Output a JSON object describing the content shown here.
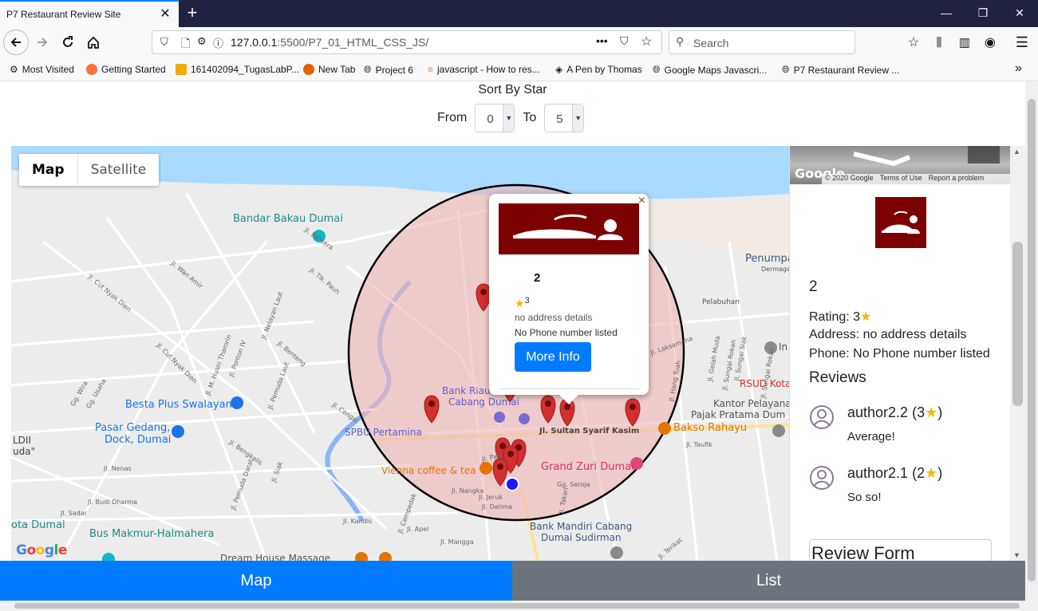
{
  "browser": {
    "tab_title": "P7 Restaurant Review Site",
    "url_host": "127.0.0.1",
    "url_rest": ":5500/P7_01_HTML_CSS_JS/",
    "url_menu": "•••",
    "search_placeholder": "Search",
    "bookmarks": [
      {
        "label": "Most Visited",
        "icon": "gear-icon"
      },
      {
        "label": "Getting Started",
        "icon": "firefox-icon"
      },
      {
        "label": "161402094_TugasLabP...",
        "icon": "doc-icon"
      },
      {
        "label": "New Tab",
        "icon": "firefox-icon"
      },
      {
        "label": "Project 6",
        "icon": "globe-icon"
      },
      {
        "label": "javascript - How to res...",
        "icon": "stackoverflow-icon"
      },
      {
        "label": "A Pen by Thomas",
        "icon": "codepen-icon"
      },
      {
        "label": "Google Maps Javascri...",
        "icon": "globe-icon"
      },
      {
        "label": "P7 Restaurant Review ...",
        "icon": "globe-icon"
      }
    ]
  },
  "sort": {
    "title": "Sort By Star",
    "from_label": "From",
    "from_value": "0",
    "to_label": "To",
    "to_value": "5"
  },
  "map": {
    "type_map": "Map",
    "type_satellite": "Satellite",
    "labels": [
      {
        "text": "Bandar Bakau Dumai",
        "color": "#1e8a8a"
      },
      {
        "text": "Penumpa",
        "color": "#3d5a80"
      },
      {
        "text": "Besta Plus Swalayan",
        "color": "#1a73e8"
      },
      {
        "text": "Pasar Gedang,",
        "color": "#1a73e8"
      },
      {
        "text": "Dock, Dumai",
        "color": "#1a73e8"
      },
      {
        "text": "Bank Riau",
        "color": "#5f5fd0"
      },
      {
        "text": "Cabang Dumai",
        "color": "#5f5fd0"
      },
      {
        "text": "SPBU Pertamina",
        "color": "#5f5fd0"
      },
      {
        "text": "Jl. Sultan Syarif Kasim",
        "color": "#444444"
      },
      {
        "text": "Grand Zuri Dumai",
        "color": "#d8336b"
      },
      {
        "text": "Vienna coffee & tea",
        "color": "#e37400"
      },
      {
        "text": "Bakso Rahayu",
        "color": "#e37400"
      },
      {
        "text": "Bank Mandiri Cabang",
        "color": "#3d5a80"
      },
      {
        "text": "Dumai Sudirman",
        "color": "#3d5a80"
      },
      {
        "text": "Kantor Pelayanan",
        "color": "#555555"
      },
      {
        "text": "Pajak Pratama Dum",
        "color": "#555555"
      },
      {
        "text": "RSUD Kota",
        "color": "#d93025"
      },
      {
        "text": "Bus Makmur-Halmahera",
        "color": "#1e8a8a"
      },
      {
        "text": "ota Dumai",
        "color": "#1e8a8a"
      },
      {
        "text": "LDII",
        "color": "#444444"
      },
      {
        "text": "uda\"",
        "color": "#444444"
      },
      {
        "text": "Dream House Massage",
        "color": "#555555"
      },
      {
        "text": "Pelabuhan",
        "color": "#555555"
      },
      {
        "text": "Dermaga",
        "color": "#555555"
      },
      {
        "text": "In",
        "color": "#555555"
      },
      {
        "text": "Google",
        "color": "#4285f4"
      }
    ],
    "roads": [
      "Jl. Bahtera",
      "Jl. Wan Amir",
      "Jl. Cut Nyak Dien",
      "Jl. Tlk. Pauh",
      "Jl. Nelayan Laut",
      "Jl. M. Husni Thamrin",
      "Jl. Ponton IV",
      "Jl. Benteng",
      "Jl. Cut Nyak Dien",
      "Gg. Wira",
      "Gg. Usaha",
      "Jl. Pemuda Laut",
      "Jl. Cengal",
      "Jl. Pala",
      "Jl. Nangka",
      "Jl. Jeruk",
      "Jl. Delima",
      "Jl. Cempedak",
      "Jl. Apel",
      "Jl. Mangga",
      "Jl. Sadar",
      "Jl. Budi Dharma",
      "Jl. Nenas",
      "Jl. Bengkalis",
      "Jl. Siak",
      "Jl. Pemuda Darat",
      "Jl. Kandis",
      "Jl. Taufik",
      "Gg. Seroja",
      "Jl. Laksamana",
      "Jl. Hang Tuah",
      "Jl. Sungai Rokan",
      "Jl. Sungai Siak",
      "Jl. Gelah Muda",
      "Jl. Sungai Rokan",
      "Jl. Takari",
      "Jl. Terikat"
    ],
    "info_window": {
      "close": "×",
      "name": "2",
      "rating": "3",
      "address": "no address details",
      "phone": "No Phone number listed",
      "button": "More Info"
    }
  },
  "panel": {
    "streetview_footer": [
      "© 2020 Google",
      "Terms of Use",
      "Report a problem"
    ],
    "streetview_logo": "Google",
    "name": "2",
    "rating_label": "Rating: 3",
    "address": "Address: no address details",
    "phone": "Phone: No Phone number listed",
    "reviews_title": "Reviews",
    "reviews": [
      {
        "author": "author2.2",
        "stars": "3",
        "text": "Average!"
      },
      {
        "author": "author2.1",
        "stars": "2",
        "text": "So so!"
      }
    ],
    "form_title": "Review Form"
  },
  "bottom": {
    "map_label": "Map",
    "list_label": "List"
  },
  "colors": {
    "primary": "#007bff",
    "secondary": "#6c757d",
    "brand_red": "#7d0000",
    "star": "#f5b800",
    "circle_fill": "#f0b5b5",
    "marker": "#d32f2f"
  }
}
